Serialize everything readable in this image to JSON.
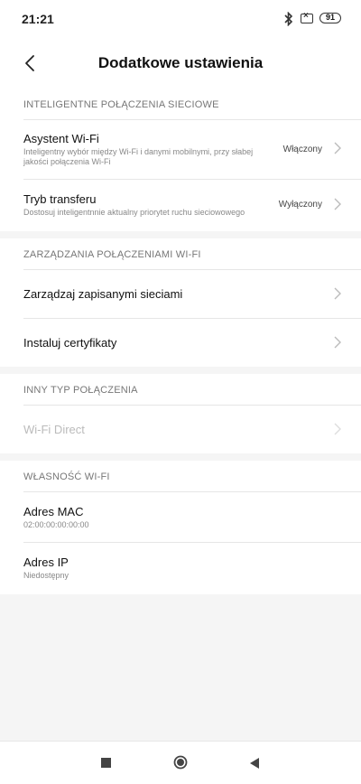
{
  "status": {
    "time": "21:21",
    "battery": "91"
  },
  "header": {
    "title": "Dodatkowe ustawienia"
  },
  "sections": [
    {
      "header": "INTELIGENTNE POŁĄCZENIA SIECIOWE",
      "items": [
        {
          "title": "Asystent Wi-Fi",
          "subtitle_line1": "Inteligentny wybór między Wi-Fi i danymi mobilnymi, przy słabej",
          "subtitle_line2": "jakości połączenia Wi-Fi",
          "value": "Włączony"
        },
        {
          "title": "Tryb transferu",
          "subtitle": "Dostosuj inteligentnnie aktualny priorytet ruchu sieciowowego",
          "value": "Wyłączony"
        }
      ]
    },
    {
      "header": "ZARZĄDZANIA POŁĄCZENIAMI WI-FI",
      "items": [
        {
          "title": "Zarządzaj zapisanymi sieciami"
        },
        {
          "title": "Instaluj certyfikaty"
        }
      ]
    },
    {
      "header": "INNY TYP POŁĄCZENIA",
      "items": [
        {
          "title": "Wi-Fi Direct"
        }
      ]
    },
    {
      "header": "WŁASNOŚĆ WI-FI",
      "items": [
        {
          "title": "Adres MAC",
          "subtitle": "02:00:00:00:00:00"
        },
        {
          "title": "Adres IP",
          "subtitle": "Niedostępny"
        }
      ]
    }
  ],
  "icons": {
    "bluetooth": "bluetooth-icon",
    "sim": "sim-disabled-icon",
    "battery": "battery-icon",
    "back": "back-arrow-icon",
    "chevron": "chevron-right-icon",
    "nav_recents": "recents-square-icon",
    "nav_home": "home-circle-icon",
    "nav_back": "back-triangle-icon"
  }
}
